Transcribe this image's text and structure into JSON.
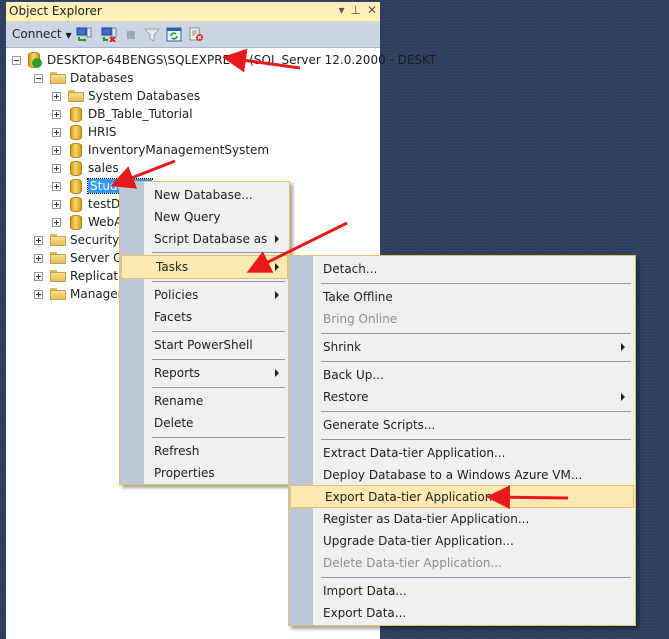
{
  "panel": {
    "title": "Object Explorer",
    "title_buttons": [
      "▾",
      "⊥",
      "✕"
    ],
    "toolbar": {
      "connect_label": "Connect",
      "icons": [
        "connect-object-explorer-icon",
        "disconnect-icon",
        "stop-icon",
        "filter-icon",
        "refresh-icon",
        "activity-monitor-icon"
      ]
    }
  },
  "tree": {
    "server": "DESKTOP-64BENGS\\SQLEXPRESS (SQL Server 12.0.2000 - DESKT",
    "databases_label": "Databases",
    "databases": [
      "System Databases",
      "DB_Table_Tutorial",
      "HRIS",
      "InventoryManagementSystem",
      "sales",
      "StudentInfo",
      "testDB",
      "WebApp"
    ],
    "visible_db_labels": [
      "System Databases",
      "DB_Table_Tutorial",
      "HRIS",
      "InventoryManagementSystem",
      "sales",
      "Stude",
      "testDE",
      "WebA"
    ],
    "top_folders": [
      "Security",
      "Server Ob",
      "Replicatio",
      "Managem"
    ]
  },
  "context_menu": {
    "items": [
      {
        "label": "New Database...",
        "submenu": false
      },
      {
        "label": "New Query",
        "submenu": false
      },
      {
        "label": "Script Database as",
        "submenu": true
      },
      {
        "label": "Tasks",
        "submenu": true,
        "highlighted": true
      },
      {
        "label": "Policies",
        "submenu": true
      },
      {
        "label": "Facets",
        "submenu": false
      },
      {
        "label": "Start PowerShell",
        "submenu": false
      },
      {
        "label": "Reports",
        "submenu": true
      },
      {
        "label": "Rename",
        "submenu": false
      },
      {
        "label": "Delete",
        "submenu": false
      },
      {
        "label": "Refresh",
        "submenu": false
      },
      {
        "label": "Properties",
        "submenu": false
      }
    ]
  },
  "tasks_menu": {
    "items": [
      {
        "label": "Detach...",
        "submenu": false
      },
      {
        "label": "Take Offline",
        "submenu": false
      },
      {
        "label": "Bring Online",
        "submenu": false,
        "disabled": true
      },
      {
        "label": "Shrink",
        "submenu": true
      },
      {
        "label": "Back Up...",
        "submenu": false
      },
      {
        "label": "Restore",
        "submenu": true
      },
      {
        "label": "Generate Scripts...",
        "submenu": false
      },
      {
        "label": "Extract Data-tier Application...",
        "submenu": false
      },
      {
        "label": "Deploy Database to a Windows Azure VM...",
        "submenu": false
      },
      {
        "label": "Export Data-tier Application...",
        "submenu": false,
        "highlighted": true
      },
      {
        "label": "Register as Data-tier Application...",
        "submenu": false
      },
      {
        "label": "Upgrade Data-tier Application...",
        "submenu": false
      },
      {
        "label": "Delete Data-tier Application...",
        "submenu": false,
        "disabled": true
      },
      {
        "label": "Import Data...",
        "submenu": false
      },
      {
        "label": "Export Data...",
        "submenu": false
      }
    ]
  },
  "colors": {
    "highlight": "#fdeab3",
    "selection": "#3399ff",
    "annotation_arrow": "#e8191b",
    "background": "#2e3f5f"
  }
}
